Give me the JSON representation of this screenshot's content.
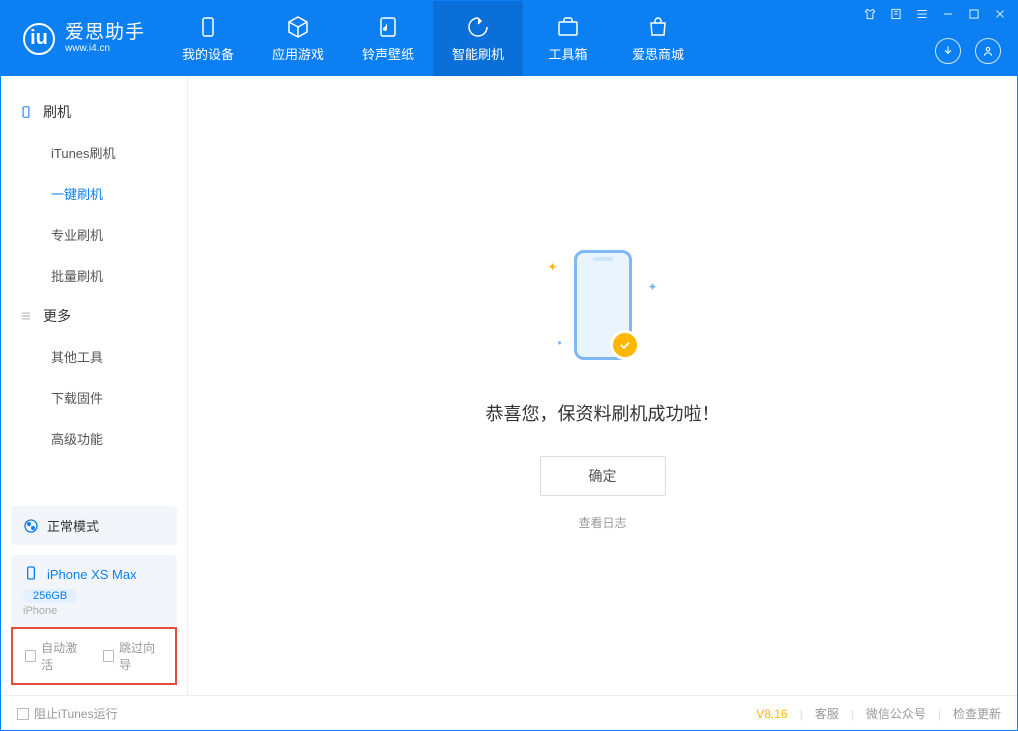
{
  "logo": {
    "title": "爱思助手",
    "subtitle": "www.i4.cn"
  },
  "nav": {
    "device": "我的设备",
    "apps": "应用游戏",
    "ringtone": "铃声壁纸",
    "flash": "智能刷机",
    "toolbox": "工具箱",
    "store": "爱思商城"
  },
  "sidebar": {
    "section_flash": "刷机",
    "itunes_flash": "iTunes刷机",
    "oneclick_flash": "一键刷机",
    "pro_flash": "专业刷机",
    "batch_flash": "批量刷机",
    "section_more": "更多",
    "other_tools": "其他工具",
    "download_fw": "下载固件",
    "advanced": "高级功能"
  },
  "mode": {
    "label": "正常模式"
  },
  "device": {
    "name": "iPhone XS Max",
    "storage": "256GB",
    "type": "iPhone"
  },
  "options": {
    "auto_activate": "自动激活",
    "skip_guide": "跳过向导"
  },
  "main": {
    "success_text": "恭喜您，保资料刷机成功啦！",
    "ok": "确定",
    "view_log": "查看日志"
  },
  "footer": {
    "block_itunes": "阻止iTunes运行",
    "version": "V8.16",
    "support": "客服",
    "wechat": "微信公众号",
    "update": "检查更新"
  }
}
